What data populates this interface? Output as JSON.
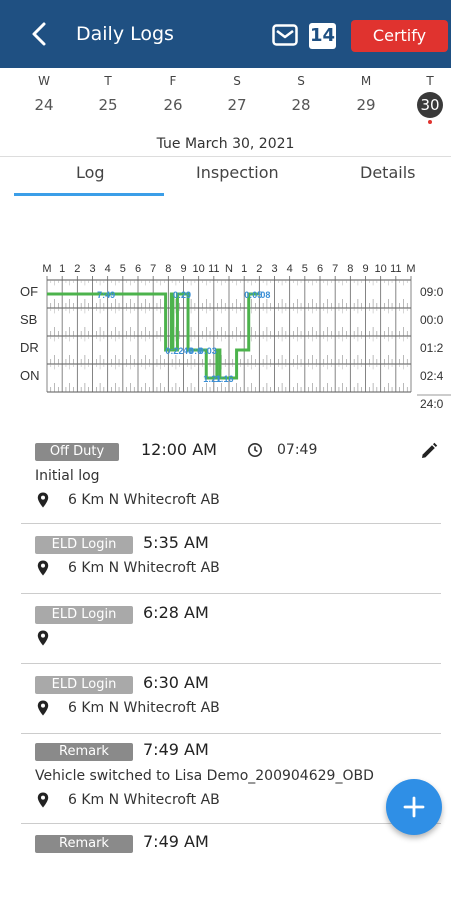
{
  "header": {
    "title": "Daily Logs",
    "badge_count": "14",
    "certify_label": "Certify",
    "bg_color": "#1f5082",
    "certify_color": "#e0332f"
  },
  "week": [
    {
      "letter": "W",
      "num": "24"
    },
    {
      "letter": "T",
      "num": "25"
    },
    {
      "letter": "F",
      "num": "26"
    },
    {
      "letter": "S",
      "num": "27"
    },
    {
      "letter": "S",
      "num": "28"
    },
    {
      "letter": "M",
      "num": "29"
    },
    {
      "letter": "T",
      "num": "30"
    }
  ],
  "selected_date": "Tue March 30, 2021",
  "tabs": [
    {
      "label": "Log",
      "active": true
    },
    {
      "label": "Inspection",
      "active": false
    },
    {
      "label": "Details",
      "active": false
    }
  ],
  "chart_data": {
    "type": "line",
    "hour_labels": [
      "M",
      "1",
      "2",
      "3",
      "4",
      "5",
      "6",
      "7",
      "8",
      "9",
      "10",
      "11",
      "N",
      "1",
      "2",
      "3",
      "4",
      "5",
      "6",
      "7",
      "8",
      "9",
      "10",
      "11",
      "M"
    ],
    "rows": [
      "OF",
      "SB",
      "DR",
      "ON"
    ],
    "totals": [
      "09:0",
      "00:0",
      "01:2",
      "02:4",
      "24:0"
    ],
    "series_color": "#4cb34c",
    "label_color": "#3b8fd6",
    "segments": [
      {
        "status": "OF",
        "start": 0.0,
        "end": 7.82
      },
      {
        "status": "DR",
        "start": 7.82,
        "end": 8.2
      },
      {
        "status": "OF",
        "start": 8.2,
        "end": 8.3
      },
      {
        "status": "DR",
        "start": 8.3,
        "end": 8.6
      },
      {
        "status": "OF",
        "start": 8.6,
        "end": 9.3
      },
      {
        "status": "DR",
        "start": 9.3,
        "end": 10.5
      },
      {
        "status": "ON",
        "start": 10.5,
        "end": 11.2
      },
      {
        "status": "DR",
        "start": 11.2,
        "end": 11.4
      },
      {
        "status": "ON",
        "start": 11.4,
        "end": 12.5
      },
      {
        "status": "DR",
        "start": 12.5,
        "end": 13.3
      },
      {
        "status": "OF",
        "start": 13.3,
        "end": 14.0
      }
    ],
    "labels": [
      {
        "text": "7:49",
        "row": "OF"
      },
      {
        "text": "0:29",
        "row": "OF"
      },
      {
        "text": "0:05",
        "row": "OF"
      },
      {
        "text": "08",
        "row": "OF"
      },
      {
        "text": "0:22",
        "row": "DR"
      },
      {
        "text": "40",
        "row": "DR"
      },
      {
        "text": "0:0",
        "row": "DR"
      },
      {
        "text": "0:03",
        "row": "DR"
      },
      {
        "text": "1:21",
        "row": "ON"
      },
      {
        "text": "1:16",
        "row": "ON"
      }
    ]
  },
  "events": [
    {
      "status": "Off Duty",
      "time": "12:00 AM",
      "duration": "07:49",
      "note": "Initial log",
      "location": "6 Km N Whitecroft AB"
    },
    {
      "status": "ELD Login",
      "time": "5:35 AM",
      "note": "",
      "location": "6 Km N Whitecroft AB"
    },
    {
      "status": "ELD Login",
      "time": "6:28 AM",
      "note": "",
      "location": ""
    },
    {
      "status": "ELD Login",
      "time": "6:30 AM",
      "note": "",
      "location": "6 Km N Whitecroft AB"
    },
    {
      "status": "Remark",
      "time": "7:49 AM",
      "note": "Vehicle switched to Lisa Demo_200904629_OBD",
      "location": "6 Km N Whitecroft AB"
    },
    {
      "status": "Remark",
      "time": "7:49 AM",
      "note": "",
      "location": ""
    }
  ]
}
